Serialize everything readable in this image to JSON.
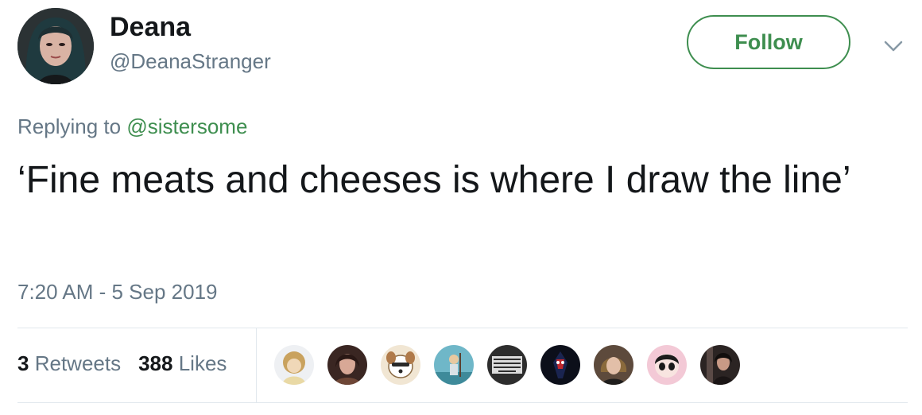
{
  "author": {
    "display_name": "Deana",
    "handle": "@DeanaStranger"
  },
  "follow_label": "Follow",
  "reply_context": {
    "prefix": "Replying to",
    "mention": "@sistersome"
  },
  "tweet_text": "‘Fine meats and cheeses is where I draw the line’",
  "timestamp": "7:20 AM - 5 Sep 2019",
  "stats": {
    "retweets_count": "3",
    "retweets_label": "Retweets",
    "likes_count": "388",
    "likes_label": "Likes"
  },
  "liker_avatars": [
    {
      "icon": "cartoon-avatar-icon",
      "color": "#c9b06a"
    },
    {
      "icon": "person-avatar-icon",
      "color": "#5a3b33"
    },
    {
      "icon": "cartoon-dog-avatar-icon",
      "color": "#d7b58a"
    },
    {
      "icon": "cartoon-figure-avatar-icon",
      "color": "#4a9ab0"
    },
    {
      "icon": "text-badge-avatar-icon",
      "color": "#3a3a3a",
      "text": "I NEVER MET A BANNED BOOK I DIDN'T WANT TO READ"
    },
    {
      "icon": "spider-hero-avatar-icon",
      "color": "#10131d"
    },
    {
      "icon": "person-avatar-icon",
      "color": "#6b5040"
    },
    {
      "icon": "cartoon-girl-avatar-icon",
      "color": "#e8b6c2"
    },
    {
      "icon": "person-avatar-icon",
      "color": "#3a3231"
    }
  ],
  "colors": {
    "accent": "#3e8e4f",
    "secondary_text": "#657786",
    "primary_text": "#14171a",
    "divider": "#e1e8ed"
  }
}
